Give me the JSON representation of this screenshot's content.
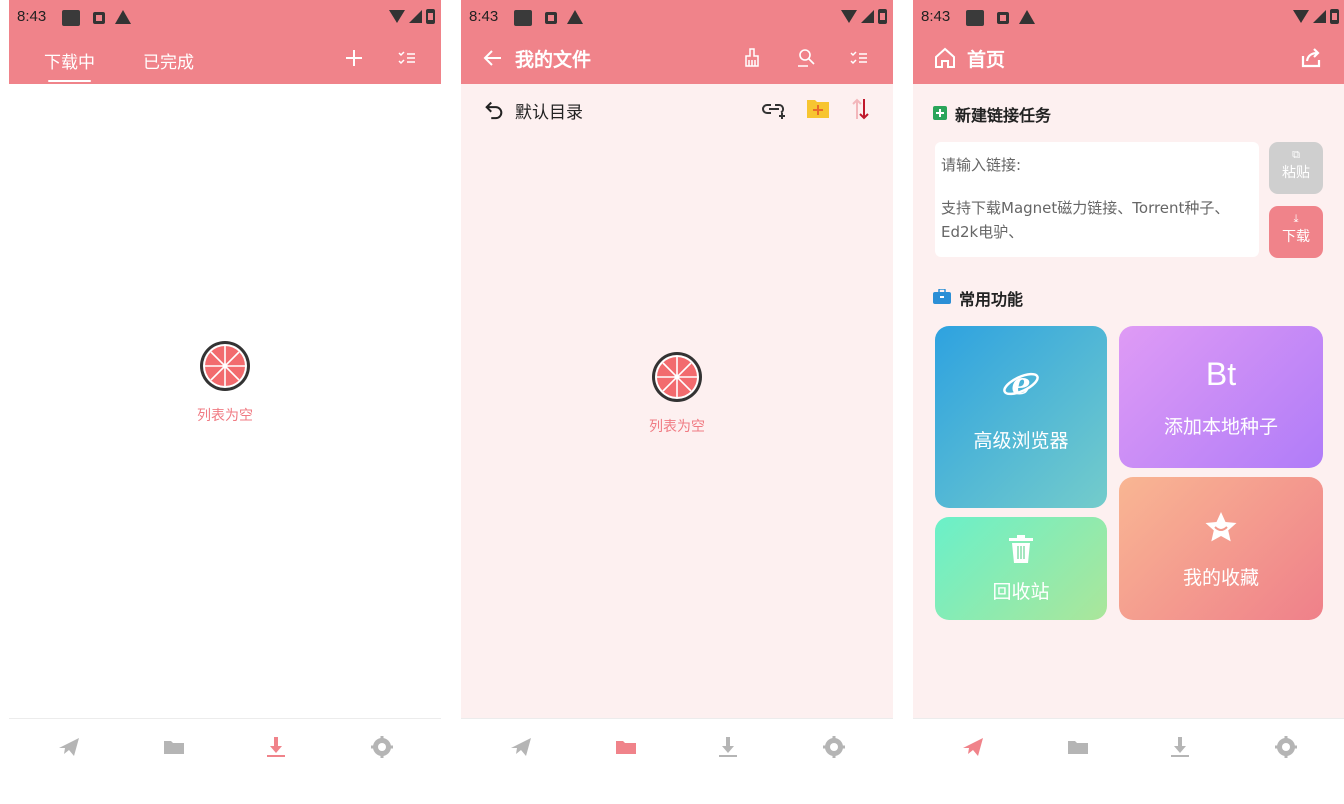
{
  "status_bar": {
    "time": "8:43"
  },
  "screen1": {
    "tabs": [
      {
        "label": "下载中"
      },
      {
        "label": "已完成"
      }
    ],
    "empty_label": "列表为空"
  },
  "screen2": {
    "title": "我的文件",
    "folder_label": "默认目录",
    "empty_label": "列表为空"
  },
  "screen3": {
    "title": "首页",
    "new_task_title": "新建链接任务",
    "link_placeholder": "请输入链接:",
    "link_hint": "支持下载Magnet磁力链接、Torrent种子、Ed2k电驴、",
    "paste_label": "粘贴",
    "download_label": "下载",
    "features_title": "常用功能",
    "cards": {
      "browser": "高级浏览器",
      "bt_badge": "Bt",
      "add_torrent": "添加本地种子",
      "recycle": "回收站",
      "favorites": "我的收藏"
    }
  },
  "colors": {
    "primary": "#f0838a",
    "nav_inactive": "#b5b5b5"
  },
  "icons": {
    "nav": [
      "send-icon",
      "folder-icon",
      "download-icon",
      "gear-icon"
    ]
  }
}
